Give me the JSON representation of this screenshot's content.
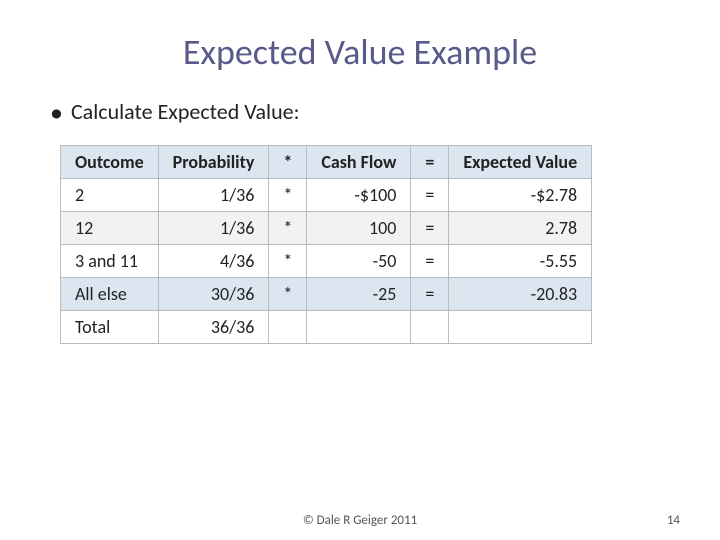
{
  "title": "Expected Value Example",
  "bullet": "Calculate Expected Value:",
  "table": {
    "headers": [
      "Outcome",
      "Probability",
      "*",
      "Cash Flow",
      "=",
      "Expected Value"
    ],
    "rows": [
      {
        "outcome": "2",
        "probability": "1/36",
        "star": "*",
        "cashflow": "-$100",
        "eq": "=",
        "expected": "-$2.78",
        "highlight": false
      },
      {
        "outcome": "12",
        "probability": "1/36",
        "star": "*",
        "cashflow": "100",
        "eq": "=",
        "expected": "2.78",
        "highlight": false
      },
      {
        "outcome": "3 and 11",
        "probability": "4/36",
        "star": "*",
        "cashflow": "-50",
        "eq": "=",
        "expected": "-5.55",
        "highlight": false
      },
      {
        "outcome": "All else",
        "probability": "30/36",
        "star": "*",
        "cashflow": "-25",
        "eq": "=",
        "expected": "-20.83",
        "highlight": true
      },
      {
        "outcome": "Total",
        "probability": "36/36",
        "star": "",
        "cashflow": "",
        "eq": "",
        "expected": "",
        "highlight": false
      }
    ]
  },
  "footer": {
    "copyright": "© Dale R Geiger 2011",
    "page": "14"
  }
}
